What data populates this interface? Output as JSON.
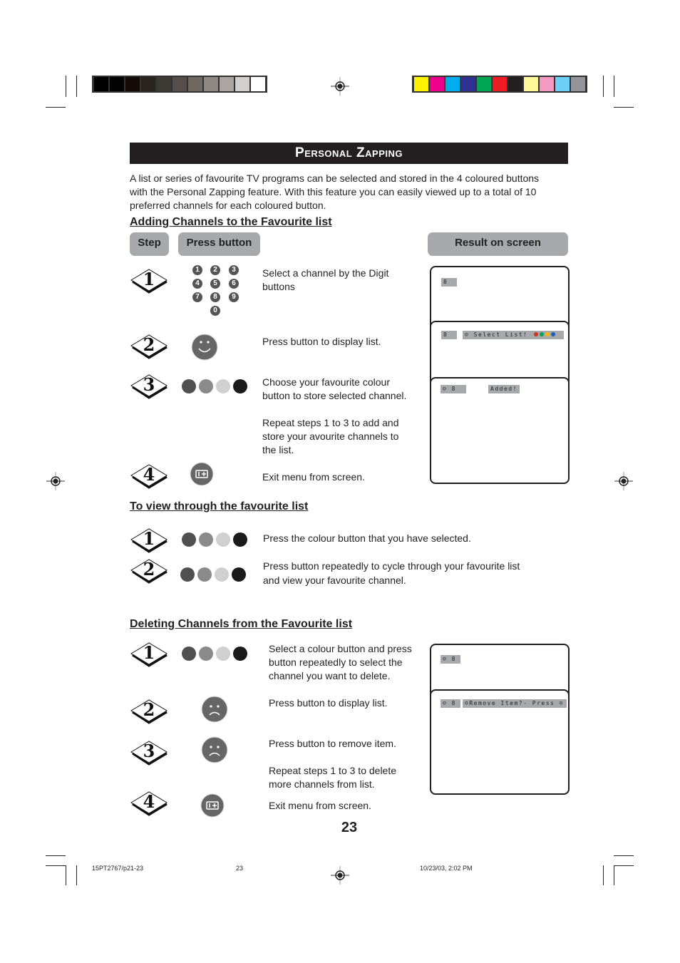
{
  "registration": {
    "gray_bar": [
      "#000000",
      "#030303",
      "#140b09",
      "#29241f",
      "#3d3934",
      "#564e4a",
      "#706763",
      "#8f8784",
      "#aaa5a2",
      "#d2cfce",
      "#ffffff"
    ],
    "color_bar": [
      "#fff200",
      "#ec008c",
      "#00aeef",
      "#2e3192",
      "#00a651",
      "#ed1c24",
      "#231f20",
      "#fff799",
      "#f49ac1",
      "#6dcff6",
      "#939598"
    ]
  },
  "title": "Personal Zapping",
  "intro": [
    "A list or series of favourite TV programs can be selected and stored in the 4 coloured buttons",
    "with the Personal Zapping feature. With this feature you can easily viewed up to a total of 10",
    "preferred channels for each coloured button."
  ],
  "colour_buttons": [
    "#505050",
    "#8a8a8a",
    "#d0d0d0",
    "#1a1a1a"
  ],
  "adding": {
    "heading": "Adding Channels to the Favourite list",
    "headers": {
      "step": "Step",
      "press": "Press button",
      "result": "Result on screen"
    },
    "digits": [
      "1",
      "2",
      "3",
      "4",
      "5",
      "6",
      "7",
      "8",
      "9",
      "0"
    ],
    "steps": [
      {
        "num": "1",
        "text": [
          "Select a channel by the Digit",
          "buttons"
        ],
        "icon": "digit-buttons"
      },
      {
        "num": "2",
        "text": [
          "Press button to display list."
        ],
        "icon": "smiley-button"
      },
      {
        "num": "3",
        "text": [
          "Choose your favourite colour",
          "button to store selected channel."
        ],
        "icon": "colour-buttons"
      },
      {
        "num": "",
        "text": [
          "Repeat steps 1 to 3 to add and",
          "store your avourite channels to",
          "the list."
        ]
      },
      {
        "num": "4",
        "text": [
          "Exit menu from screen."
        ],
        "icon": "menu-button"
      }
    ],
    "screens": {
      "s1_channel": "8",
      "s2_channel": "8",
      "s2_message": "Select List!",
      "s2_dots": [
        "#d2321e",
        "#00a651",
        "#f7b500",
        "#1a5fb4"
      ],
      "s3_channel": "8",
      "s3_message": "Added!"
    }
  },
  "viewing": {
    "heading": "To view through the favourite list",
    "steps": [
      {
        "num": "1",
        "text": [
          "Press the colour button that you have selected."
        ]
      },
      {
        "num": "2",
        "text": [
          "Press button repeatedly to cycle through your favourite list",
          "and view your favourite channel."
        ]
      }
    ]
  },
  "deleting": {
    "heading": "Deleting Channels from the Favourite list",
    "steps": [
      {
        "num": "1",
        "text": [
          "Select a colour button and press",
          "button repeatedly to select the",
          "channel you want to delete."
        ],
        "icon": "colour-buttons"
      },
      {
        "num": "2",
        "text": [
          "Press button to display list."
        ],
        "icon": "sad-face-button"
      },
      {
        "num": "3",
        "text": [
          "Press button to remove item."
        ],
        "icon": "sad-face-button"
      },
      {
        "num": "",
        "text": [
          "Repeat steps 1 to 3 to delete",
          "more channels from list."
        ]
      },
      {
        "num": "4",
        "text": [
          "Exit menu from screen."
        ],
        "icon": "menu-button"
      }
    ],
    "screens": {
      "s1_channel": "8",
      "s2_channel": "8",
      "s2_message": "Remove Item?- Press"
    }
  },
  "page_number": "23",
  "footer": {
    "file": "15PT2767/p21-23",
    "page": "23",
    "date": "10/23/03, 2:02 PM"
  }
}
